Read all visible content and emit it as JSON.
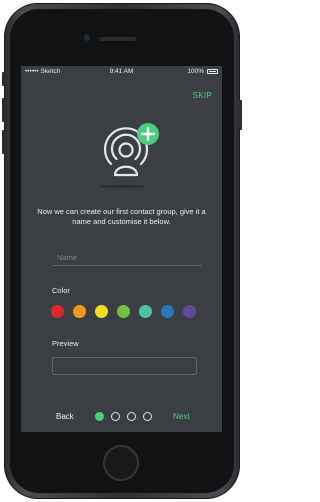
{
  "status_bar": {
    "carrier": "•••••• Sketch",
    "time": "9:41 AM",
    "battery": "100%"
  },
  "header": {
    "skip_label": "SKIP"
  },
  "intro": {
    "text": "Now we can create our first contact group, give it a name and customise it below."
  },
  "name_field": {
    "placeholder": "Name",
    "value": ""
  },
  "color_section": {
    "label": "Color",
    "swatches": [
      {
        "name": "red",
        "color": "#e0262c"
      },
      {
        "name": "orange",
        "color": "#f29a1f"
      },
      {
        "name": "yellow",
        "color": "#f1de1c"
      },
      {
        "name": "green",
        "color": "#75c043"
      },
      {
        "name": "teal",
        "color": "#4cc3a6"
      },
      {
        "name": "blue",
        "color": "#2c76bf"
      },
      {
        "name": "purple",
        "color": "#5e4ba0"
      }
    ]
  },
  "preview": {
    "label": "Preview"
  },
  "footer": {
    "back_label": "Back",
    "next_label": "Next",
    "page_dots": {
      "total": 4,
      "active": 1
    }
  },
  "colors": {
    "accent": "#4ccf7c",
    "screen_bg": "#3b3f43",
    "text": "#eef0f1"
  },
  "icons": {
    "hero": "contact-broadcast-icon",
    "add": "plus-icon"
  }
}
